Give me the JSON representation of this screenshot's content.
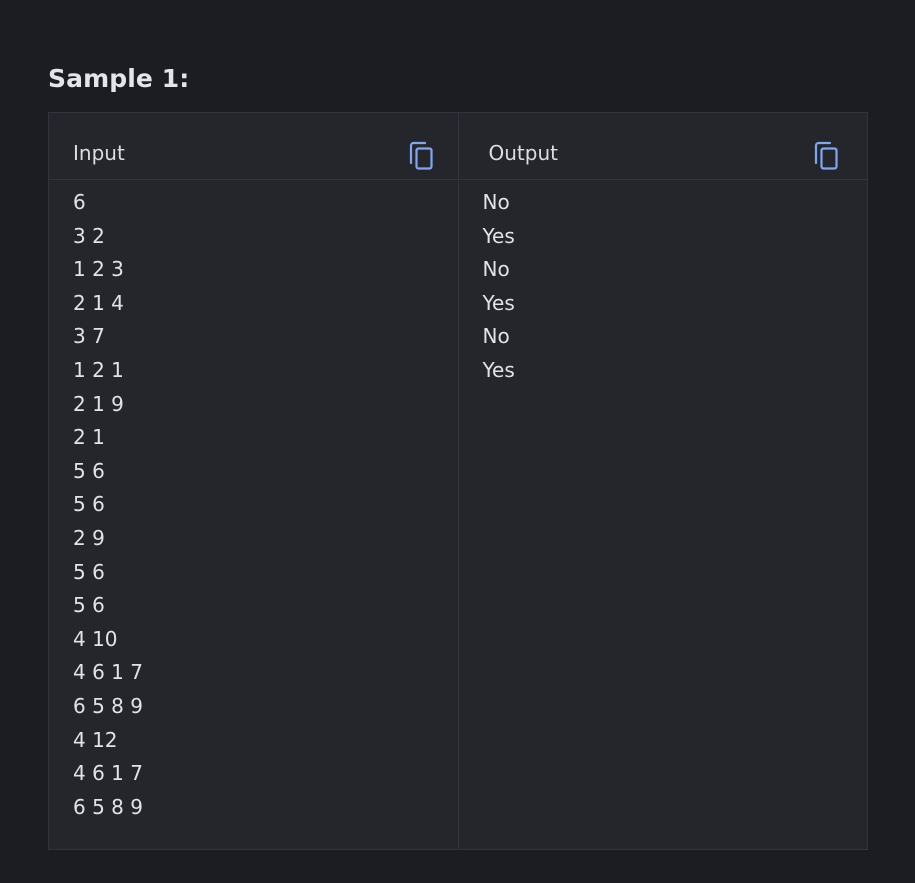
{
  "sample": {
    "title": "Sample 1:",
    "input": {
      "label": "Input",
      "copy_icon": "copy-icon",
      "lines": [
        "6",
        "3 2",
        "1 2 3",
        "2 1 4",
        "3 7",
        "1 2 1",
        "2 1 9",
        "2 1",
        "5 6",
        "5 6",
        "2 9",
        "5 6",
        "5 6",
        "4 10",
        "4 6 1 7",
        "6 5 8 9",
        "4 12",
        "4 6 1 7",
        "6 5 8 9"
      ]
    },
    "output": {
      "label": "Output",
      "copy_icon": "copy-icon",
      "lines": [
        "No",
        "Yes",
        "No",
        "Yes",
        "No",
        "Yes"
      ]
    }
  },
  "colors": {
    "background": "#1c1d22",
    "panel": "#25262c",
    "border": "#33343d",
    "text": "#e2e3e8",
    "accent": "#7ea7f2"
  }
}
